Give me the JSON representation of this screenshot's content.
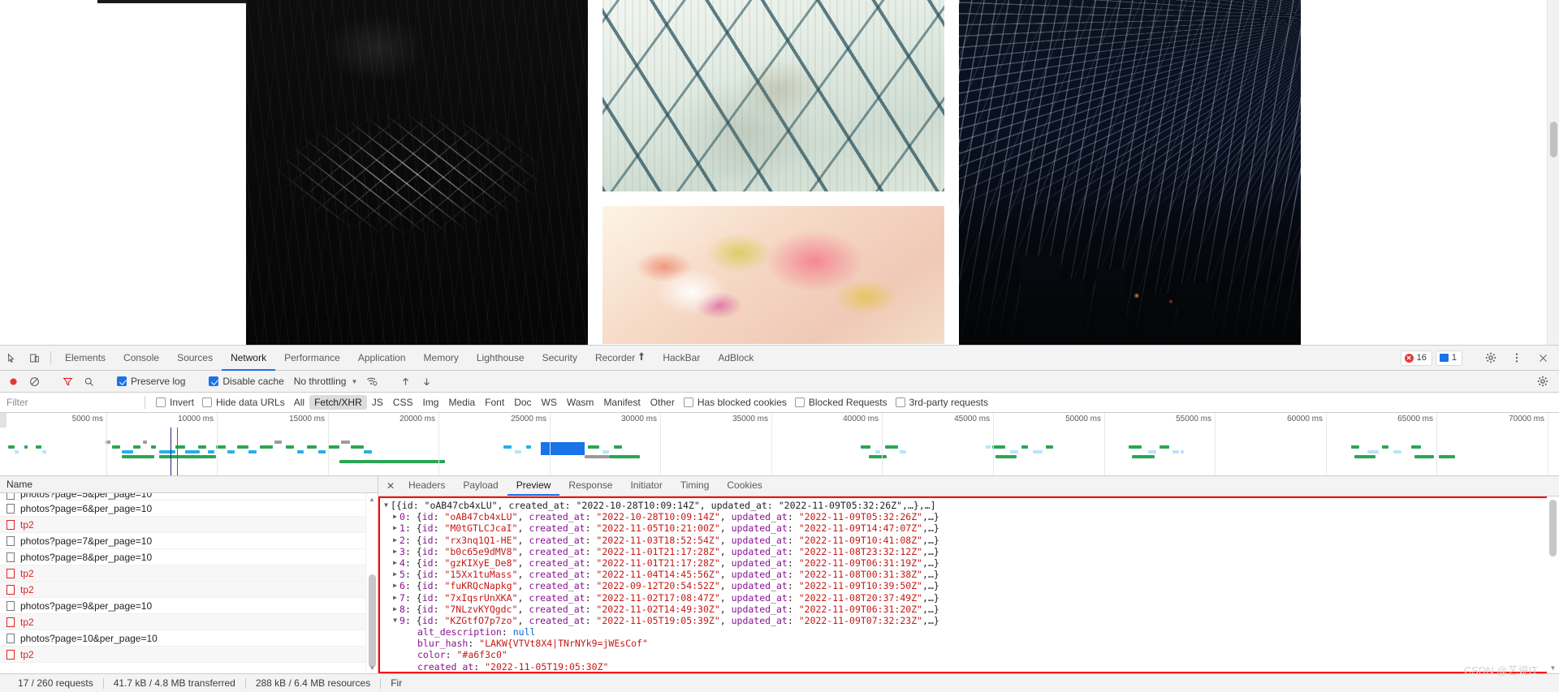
{
  "page": {
    "gallery": {
      "columns": [
        {
          "photos": [
            {
              "name": "light-trails-photo",
              "alt": "dark long exposure light trails"
            }
          ]
        },
        {
          "photos": [
            {
              "name": "branches-photo",
              "alt": "pale teal abstract crossing branches"
            },
            {
              "name": "watercolor-photo",
              "alt": "pink and yellow watercolor bloom"
            }
          ]
        },
        {
          "photos": [
            {
              "name": "star-trails-photo",
              "alt": "night sky star trails over buildings"
            }
          ]
        }
      ]
    }
  },
  "devtools": {
    "tabs": [
      {
        "label": "Elements",
        "active": false
      },
      {
        "label": "Console",
        "active": false
      },
      {
        "label": "Sources",
        "active": false
      },
      {
        "label": "Network",
        "active": true
      },
      {
        "label": "Performance",
        "active": false
      },
      {
        "label": "Application",
        "active": false
      },
      {
        "label": "Memory",
        "active": false
      },
      {
        "label": "Lighthouse",
        "active": false
      },
      {
        "label": "Security",
        "active": false
      },
      {
        "label": "Recorder",
        "active": false,
        "badge": "⏺"
      },
      {
        "label": "HackBar",
        "active": false
      },
      {
        "label": "AdBlock",
        "active": false
      }
    ],
    "counters": {
      "errors": "16",
      "messages": "1"
    },
    "icons": {
      "inspect": "inspect-element-icon",
      "device": "device-toolbar-icon",
      "settings": "gear-icon",
      "more": "more-vertical-icon",
      "close": "close-icon"
    },
    "network_toolbar": {
      "record_title": "record-button",
      "clear_title": "clear-button",
      "filter_title": "filter-button",
      "search_title": "search-button",
      "preserve_log": "Preserve log",
      "preserve_log_checked": true,
      "disable_cache": "Disable cache",
      "disable_cache_checked": true,
      "throttling": "No throttling",
      "import_title": "import-har-icon",
      "export_title": "export-har-icon",
      "network_conditions_title": "network-conditions-icon",
      "settings_title": "network-settings-gear-icon"
    },
    "filter_bar": {
      "placeholder": "Filter",
      "value": "",
      "invert": "Invert",
      "invert_checked": false,
      "hide_data_urls": "Hide data URLs",
      "hide_data_urls_checked": false,
      "types": [
        {
          "label": "All",
          "active": false
        },
        {
          "label": "Fetch/XHR",
          "active": true
        },
        {
          "label": "JS",
          "active": false
        },
        {
          "label": "CSS",
          "active": false
        },
        {
          "label": "Img",
          "active": false
        },
        {
          "label": "Media",
          "active": false
        },
        {
          "label": "Font",
          "active": false
        },
        {
          "label": "Doc",
          "active": false
        },
        {
          "label": "WS",
          "active": false
        },
        {
          "label": "Wasm",
          "active": false
        },
        {
          "label": "Manifest",
          "active": false
        },
        {
          "label": "Other",
          "active": false
        }
      ],
      "has_blocked_cookies": "Has blocked cookies",
      "has_blocked_cookies_checked": false,
      "blocked_requests": "Blocked Requests",
      "blocked_requests_checked": false,
      "third_party_requests": "3rd-party requests",
      "third_party_requests_checked": false
    },
    "overview": {
      "ticks": [
        "5000 ms",
        "10000 ms",
        "15000 ms",
        "20000 ms",
        "25000 ms",
        "30000 ms",
        "35000 ms",
        "40000 ms",
        "45000 ms",
        "50000 ms",
        "55000 ms",
        "60000 ms",
        "65000 ms",
        "70000 ms"
      ],
      "dom_content_loaded_color": "#1a237e",
      "load_event_color": "#d32f2f"
    },
    "request_list": {
      "column_header": "Name",
      "rows": [
        {
          "name": "photos?page=6&per_page=10",
          "error": false
        },
        {
          "name": "tp2",
          "error": true
        },
        {
          "name": "photos?page=7&per_page=10",
          "error": false
        },
        {
          "name": "photos?page=8&per_page=10",
          "error": false
        },
        {
          "name": "tp2",
          "error": true
        },
        {
          "name": "tp2",
          "error": true
        },
        {
          "name": "photos?page=9&per_page=10",
          "error": false
        },
        {
          "name": "tp2",
          "error": true
        },
        {
          "name": "photos?page=10&per_page=10",
          "error": false
        },
        {
          "name": "tp2",
          "error": true
        }
      ]
    },
    "detail_tabs": [
      {
        "label": "Headers",
        "active": false
      },
      {
        "label": "Payload",
        "active": false
      },
      {
        "label": "Preview",
        "active": true
      },
      {
        "label": "Response",
        "active": false
      },
      {
        "label": "Initiator",
        "active": false
      },
      {
        "label": "Timing",
        "active": false
      },
      {
        "label": "Cookies",
        "active": false
      }
    ],
    "preview": {
      "root": {
        "triangle": "▼",
        "text": "[{id: \"oAB47cb4xLU\", created_at: \"2022-10-28T10:09:14Z\", updated_at: \"2022-11-09T05:32:26Z\",…},…]"
      },
      "items": [
        {
          "index": "0",
          "triangle": "▶",
          "id": "oAB47cb4xLU",
          "created_at": "2022-10-28T10:09:14Z",
          "updated_at": "2022-11-09T05:32:26Z"
        },
        {
          "index": "1",
          "triangle": "▶",
          "id": "M0tGTLCJcaI",
          "created_at": "2022-11-05T10:21:00Z",
          "updated_at": "2022-11-09T14:47:07Z"
        },
        {
          "index": "2",
          "triangle": "▶",
          "id": "rx3nq1Q1-HE",
          "created_at": "2022-11-03T18:52:54Z",
          "updated_at": "2022-11-09T10:41:08Z"
        },
        {
          "index": "3",
          "triangle": "▶",
          "id": "b0c65e9dMV8",
          "created_at": "2022-11-01T21:17:28Z",
          "updated_at": "2022-11-08T23:32:12Z"
        },
        {
          "index": "4",
          "triangle": "▶",
          "id": "gzKIXyE_De8",
          "created_at": "2022-11-01T21:17:28Z",
          "updated_at": "2022-11-09T06:31:19Z"
        },
        {
          "index": "5",
          "triangle": "▶",
          "id": "15Xx1tuMass",
          "created_at": "2022-11-04T14:45:56Z",
          "updated_at": "2022-11-08T00:31:38Z"
        },
        {
          "index": "6",
          "triangle": "▶",
          "id": "fuKRQcNapkg",
          "created_at": "2022-09-12T20:54:52Z",
          "updated_at": "2022-11-09T10:39:50Z"
        },
        {
          "index": "7",
          "triangle": "▶",
          "id": "7xIqsrUnXKA",
          "created_at": "2022-11-02T17:08:47Z",
          "updated_at": "2022-11-08T20:37:49Z"
        },
        {
          "index": "8",
          "triangle": "▶",
          "id": "7NLzvKYQgdc",
          "created_at": "2022-11-02T14:49:30Z",
          "updated_at": "2022-11-09T06:31:20Z"
        },
        {
          "index": "9",
          "triangle": "▼",
          "id": "KZGtfO7p7zo",
          "created_at": "2022-11-05T19:05:39Z",
          "updated_at": "2022-11-09T07:32:23Z"
        }
      ],
      "expanded": [
        {
          "key": "alt_description",
          "value": "null",
          "kind": "null"
        },
        {
          "key": "blur_hash",
          "value": "\"LAKW{VTVt8X4|TNrNYk9=jWEsCof\"",
          "kind": "string"
        },
        {
          "key": "color",
          "value": "\"#a6f3c0\"",
          "kind": "string"
        },
        {
          "key": "created_at",
          "value": "\"2022-11-05T19:05:30Z\"",
          "kind": "string"
        }
      ]
    },
    "status_bar": {
      "requests": "17 / 260 requests",
      "transferred": "41.7 kB / 4.8 MB transferred",
      "resources": "288 kB / 6.4 MB resources",
      "finish_partial": "Fir"
    },
    "watermark": "CSDN @艺说IT"
  }
}
